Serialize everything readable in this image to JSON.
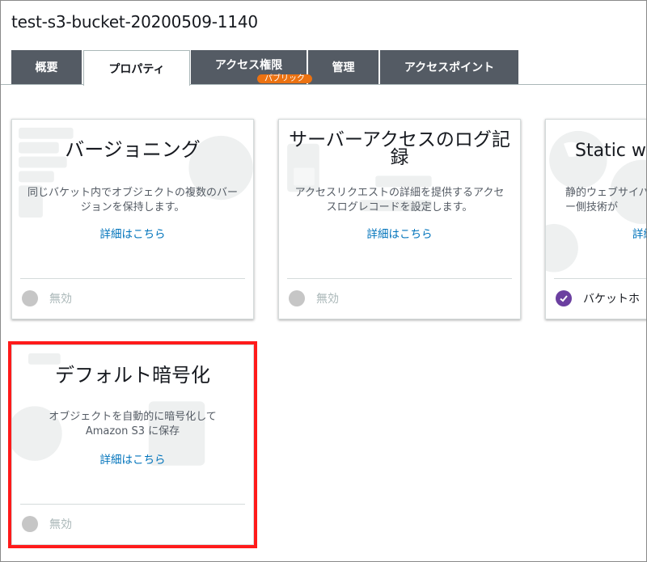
{
  "bucket": {
    "name": "test-s3-bucket-20200509-1140"
  },
  "tabs": [
    {
      "label": "概要"
    },
    {
      "label": "プロパティ"
    },
    {
      "label": "アクセス権限",
      "badge": "パブリック"
    },
    {
      "label": "管理"
    },
    {
      "label": "アクセスポイント"
    }
  ],
  "cards": {
    "versioning": {
      "title": "バージョニング",
      "desc": "同じバケット内でオブジェクトの複数のバージョンを保持します。",
      "link": "詳細はこちら",
      "status": "無効"
    },
    "logging": {
      "title": "サーバーアクセスのログ記録",
      "desc": "アクセスリクエストの詳細を提供するアクセスログレコードを設定します。",
      "link": "詳細はこちら",
      "status": "無効"
    },
    "website": {
      "title": "Static we",
      "desc": "静的ウェブサイバー側技術が",
      "link": "詳細",
      "status": "バケットホ"
    },
    "encryption": {
      "title": "デフォルト暗号化",
      "desc_line1": "オブジェクトを自動的に暗号化して",
      "desc_line2": "Amazon S3 に保存",
      "link": "詳細はこちら",
      "status": "無効"
    }
  },
  "colors": {
    "tab_bg": "#545b64",
    "link": "#0073bb",
    "badge": "#ec7211",
    "enabled_check": "#6b3fa0",
    "highlight": "#ff1a1a"
  }
}
